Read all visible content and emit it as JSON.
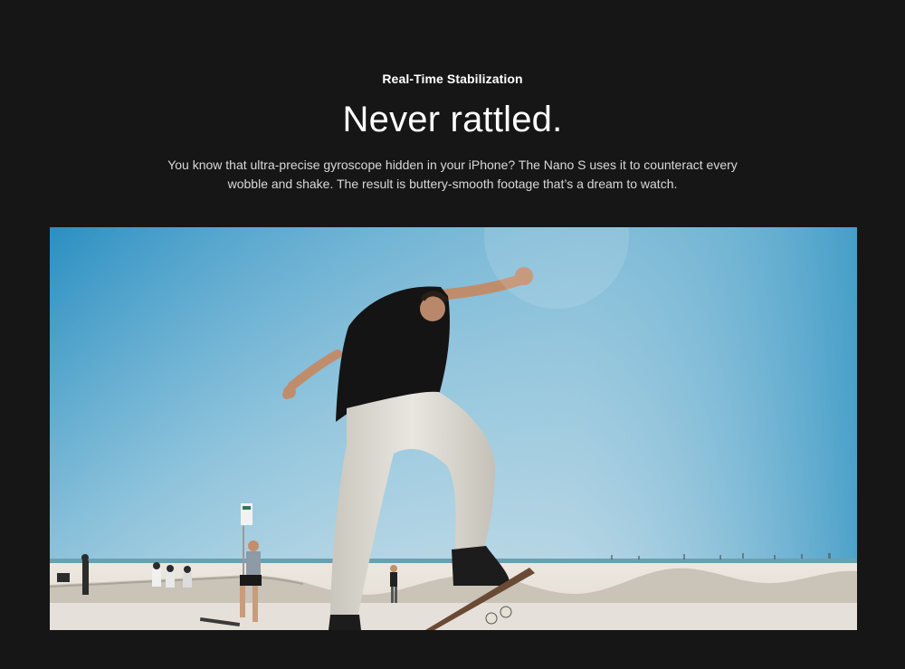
{
  "section": {
    "eyebrow": "Real-Time Stabilization",
    "headline": "Never rattled.",
    "body": "You know that ultra-precise gyroscope hidden in your iPhone? The Nano S uses it to counteract every wobble and shake. The result is buttery-smooth footage that’s a dream to watch."
  },
  "colors": {
    "page_background": "#161616",
    "sky_top": "#2f93c3",
    "sky_bottom": "#dde6ea",
    "sand": "#e7e1d8"
  }
}
